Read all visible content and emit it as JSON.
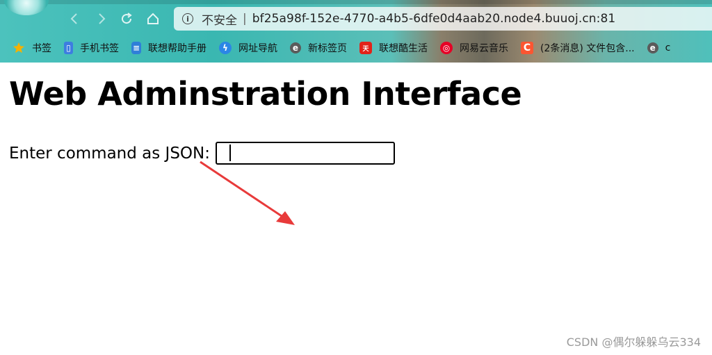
{
  "browser": {
    "address_bar": {
      "security_label": "不安全",
      "separator": "|",
      "url": "bf25a98f-152e-4770-a4b5-6dfe0d4aab20.node4.buuoj.cn:81"
    },
    "bookmarks": [
      {
        "label": "书签",
        "icon": "star-icon",
        "color": "#f5b100"
      },
      {
        "label": "手机书签",
        "icon": "phone-icon",
        "color": "#3d7de0"
      },
      {
        "label": "联想帮助手册",
        "icon": "document-icon",
        "color": "#2f7fd8"
      },
      {
        "label": "网址导航",
        "icon": "lightning-icon",
        "color": "#2b86e6"
      },
      {
        "label": "新标签页",
        "icon": "browser-e-icon",
        "color": "#5b5b5b"
      },
      {
        "label": "联想酷生活",
        "icon": "lenovo-icon",
        "color": "#e2231a"
      },
      {
        "label": "网易云音乐",
        "icon": "music-icon",
        "color": "#e60026"
      },
      {
        "label": "(2条消息) 文件包含...",
        "icon": "csdn-icon",
        "color": "#fc5531"
      },
      {
        "label": "c",
        "icon": "browser-e-icon",
        "color": "#5b5b5b"
      }
    ],
    "colors": {
      "chrome_accent": "#4cc2bd"
    }
  },
  "page": {
    "title": "Web Adminstration Interface",
    "command_label": "Enter command as JSON:",
    "command_value": ""
  },
  "watermark": "CSDN @偶尔躲躲乌云334"
}
